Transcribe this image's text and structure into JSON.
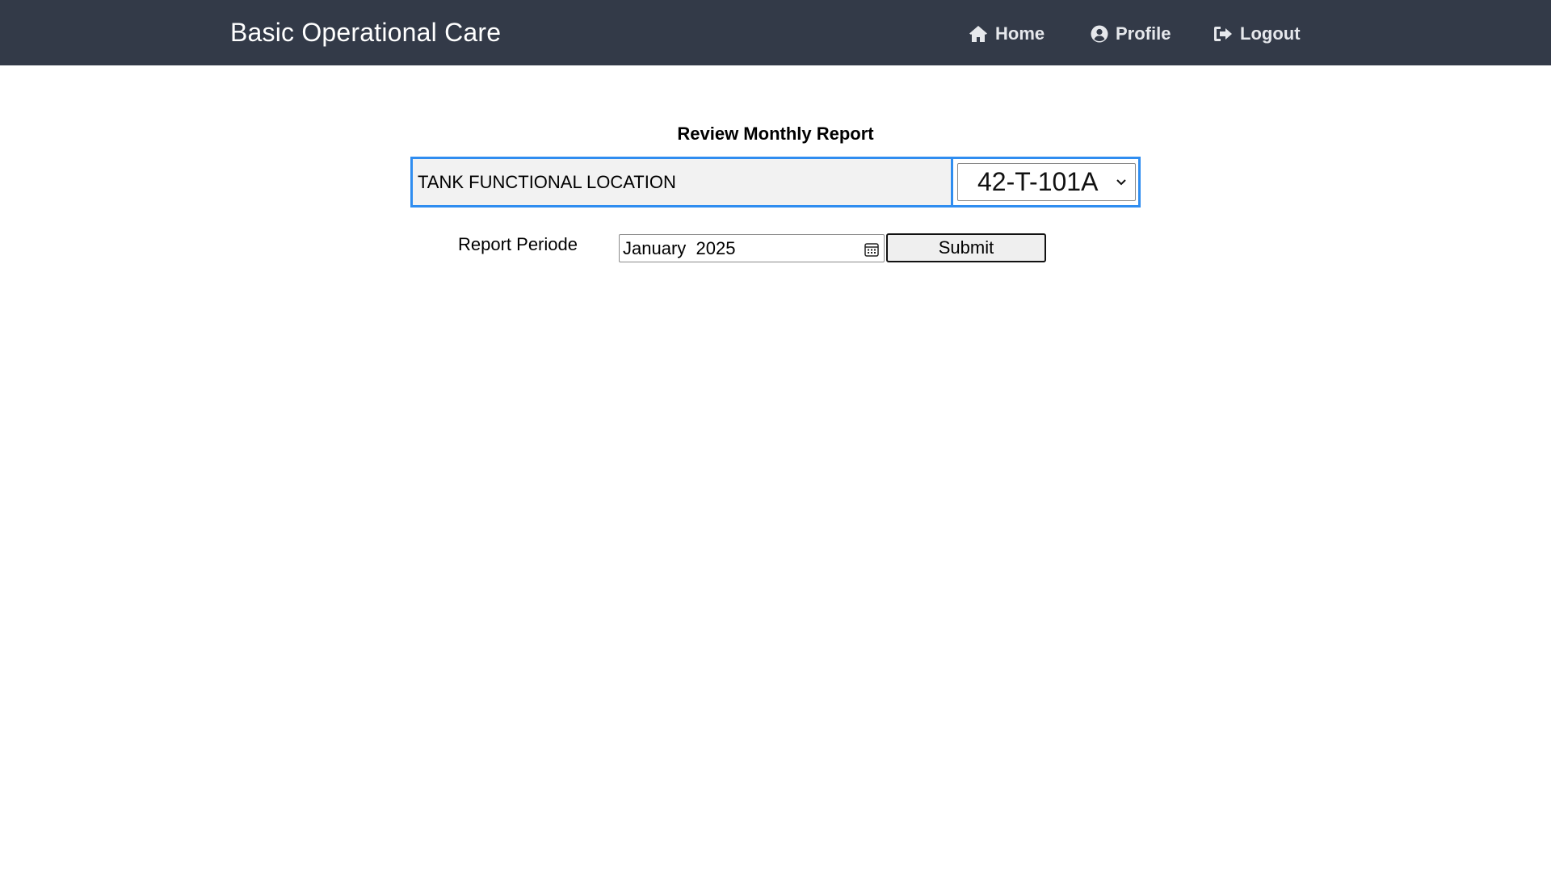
{
  "app": {
    "brand": "Basic Operational Care"
  },
  "nav": {
    "home_label": "Home",
    "profile_label": "Profile",
    "logout_label": "Logout"
  },
  "page": {
    "title": "Review Monthly Report"
  },
  "location": {
    "label": "TANK FUNCTIONAL LOCATION",
    "selected_value": "42-T-101A"
  },
  "period": {
    "label": "Report Periode",
    "value": "January  2025"
  },
  "actions": {
    "submit_label": "Submit"
  },
  "colors": {
    "navbar_bg": "#333a48",
    "accent_border": "#2f8df0",
    "label_bg": "#f2f2f2"
  },
  "icons": {
    "home": "home-icon",
    "profile": "user-circle-icon",
    "logout": "sign-out-icon",
    "select": "chevron-down-icon",
    "calendar": "calendar-icon"
  }
}
